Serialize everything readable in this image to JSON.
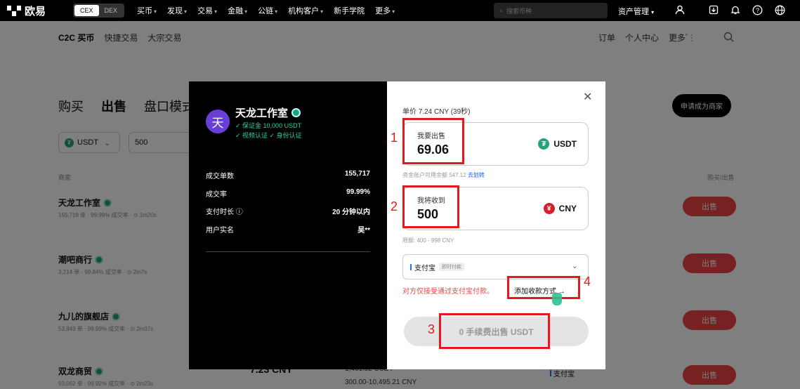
{
  "topnav": {
    "logo": "欧易",
    "cex_label": "CEX",
    "dex_label": "DEX",
    "menu": [
      "买币",
      "发现",
      "交易",
      "金融",
      "公链",
      "机构客户",
      "新手学院",
      "更多"
    ],
    "search_placeholder": "搜索币种",
    "assets_label": "资产管理"
  },
  "subnav": {
    "left": [
      "C2C 买币",
      "快捷交易",
      "大宗交易"
    ],
    "right": [
      "订单",
      "个人中心",
      "更多"
    ]
  },
  "page": {
    "tabs": [
      "购买",
      "出售",
      "盘口模式"
    ],
    "apply_button": "申请成为商家",
    "filter_coin": "USDT",
    "filter_amount": "500",
    "col_merchant": "商家",
    "col_action": "购买/出售",
    "rows": [
      {
        "name": "天龙工作室",
        "stats": "155,718 单 · 99.99% 成交率 · ⊙ 2m20s",
        "action": "出售"
      },
      {
        "name": "潮吧商行",
        "stats": "3,214 单 · 99.84% 成交率 · ⊙ 2m7s",
        "action": "出售"
      },
      {
        "name": "九儿的旗舰店",
        "stats": "53,843 单 · 99.99% 成交率 · ⊙ 2m37s",
        "action": "出售"
      },
      {
        "name": "双龙商贸",
        "stats": "93,062 单 · 99.92% 成交率 · ⊙ 2m23s",
        "action": "出售"
      }
    ],
    "last_price": "7.23 CNY",
    "last_amount": "1,461.82 USDT",
    "last_limit": "300.00-10,495.21 CNY",
    "last_pay": "支付宝"
  },
  "modal": {
    "merchant_name": "天龙工作室",
    "avatar_char": "天",
    "deposit": "✓ 保证金 10,000 USDT",
    "verify": "✓ 视频认证  ✓ 身份认证",
    "stats": [
      {
        "label": "成交单数",
        "value": "155,717"
      },
      {
        "label": "成交率",
        "value": "99.99%"
      },
      {
        "label": "支付时长 ⓘ",
        "value": "20 分钟以内"
      },
      {
        "label": "用户实名",
        "value": "吴**"
      }
    ],
    "unit_price": "单价 7.24 CNY (39秒)",
    "sell_label": "我要出售",
    "sell_value": "69.06",
    "sell_currency": "USDT",
    "available": "资金账户可用余额 547.12",
    "transfer_link": "去划转",
    "receive_label": "我将收到",
    "receive_value": "500",
    "receive_currency": "CNY",
    "limit": "限额: 400 - 998 CNY",
    "pay_method": "支付宝",
    "pay_tag": "即时付款",
    "warning": "对方仅接受通过支付宝付款。",
    "add_payment": "添加收款方式 →",
    "submit": "0 手续费出售 USDT"
  },
  "annotations": [
    "1",
    "2",
    "3",
    "4"
  ],
  "colors": {
    "accent_red": "#e8171c",
    "sell_red": "#e44444",
    "green": "#19a383",
    "tether": "#26a17b"
  }
}
